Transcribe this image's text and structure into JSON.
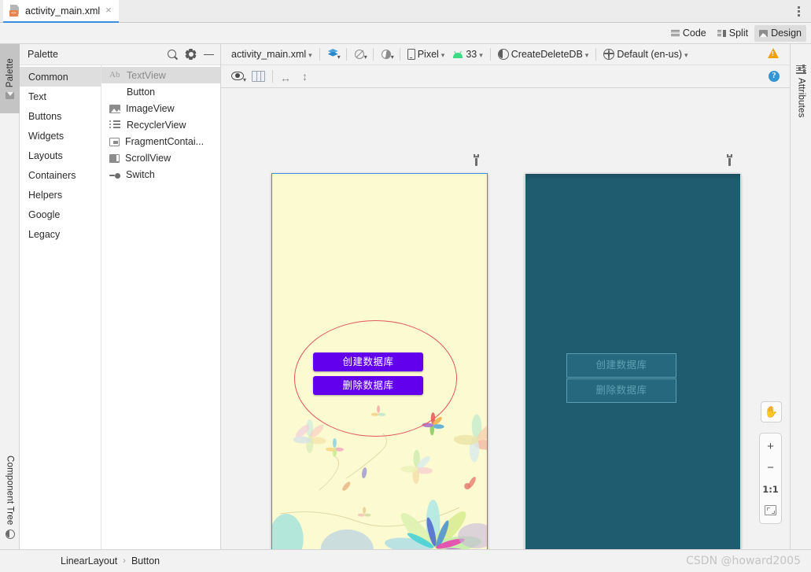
{
  "window": {
    "file_tab": "activity_main.xml",
    "tab_close": "×",
    "more_menu": "more-options"
  },
  "editor_modes": [
    {
      "label": "Code",
      "icon": "code-lines-icon",
      "active": false
    },
    {
      "label": "Split",
      "icon": "split-view-icon",
      "active": false
    },
    {
      "label": "Design",
      "icon": "design-view-icon",
      "active": true
    }
  ],
  "left_strip": {
    "palette_tab": "Palette",
    "component_tree_tab": "Component Tree"
  },
  "right_strip": {
    "attributes_tab": "Attributes"
  },
  "palette": {
    "title": "Palette",
    "search_icon": "search-icon",
    "gear_icon": "gear-icon",
    "minimize_icon": "minimize-icon",
    "categories": [
      {
        "label": "Common",
        "selected": true
      },
      {
        "label": "Text",
        "selected": false
      },
      {
        "label": "Buttons",
        "selected": false
      },
      {
        "label": "Widgets",
        "selected": false
      },
      {
        "label": "Layouts",
        "selected": false
      },
      {
        "label": "Containers",
        "selected": false
      },
      {
        "label": "Helpers",
        "selected": false
      },
      {
        "label": "Google",
        "selected": false
      },
      {
        "label": "Legacy",
        "selected": false
      }
    ],
    "widgets": [
      {
        "label": "TextView",
        "icon": "textview-icon",
        "selected": true
      },
      {
        "label": "Button",
        "icon": "button-icon",
        "selected": false
      },
      {
        "label": "ImageView",
        "icon": "imageview-icon",
        "selected": false
      },
      {
        "label": "RecyclerView",
        "icon": "recyclerview-icon",
        "selected": false
      },
      {
        "label": "FragmentContai...",
        "icon": "fragment-container-icon",
        "selected": false
      },
      {
        "label": "ScrollView",
        "icon": "scrollview-icon",
        "selected": false
      },
      {
        "label": "Switch",
        "icon": "switch-icon",
        "selected": false
      }
    ]
  },
  "design_toolbar": {
    "file_selector": "activity_main.xml",
    "view_modes_icon": "layers-icon",
    "blueprint_icon": "blueprint-toggle-icon",
    "theme_contrast_icon": "half-moon-icon",
    "device": "Pixel",
    "device_icon": "phone-icon",
    "api_level": "33",
    "api_icon": "android-icon",
    "theme": "CreateDeleteDB",
    "theme_icon": "theme-icon",
    "locale": "Default (en-us)",
    "locale_icon": "globe-icon",
    "warning_icon": "warning-triangle-icon"
  },
  "design_toolbar2": {
    "visibility_icon": "eye-icon",
    "columns_icon": "columns-layout-icon",
    "width_icon": "horizontal-resize-icon",
    "height_icon": "vertical-resize-icon",
    "help_icon": "help-icon"
  },
  "preview": {
    "design": {
      "name": "design-render-preview",
      "background_color": "#fcfad0",
      "selection_color": "#3b8ee0",
      "ellipse_color": "#e05a5a",
      "buttons": [
        {
          "label": "创建数据库",
          "color": "#6200ee"
        },
        {
          "label": "删除数据库",
          "color": "#6200ee"
        }
      ],
      "config_icon": "wrench-icon",
      "resize_handle": "resize-handle"
    },
    "blueprint": {
      "name": "blueprint-render-preview",
      "background_color": "#1f5c70",
      "outline_color": "#5c9fb3",
      "buttons": [
        {
          "label": "创建数据库"
        },
        {
          "label": "删除数据库"
        }
      ],
      "config_icon": "wrench-icon"
    }
  },
  "zoom_controls": {
    "pan_label": "✋",
    "zoom_in": "+",
    "zoom_out": "−",
    "actual_size": "1:1",
    "fit_label": "zoom-to-fit-icon"
  },
  "status": {
    "breadcrumb": [
      "LinearLayout",
      "Button"
    ],
    "separator": "›",
    "watermark": "CSDN @howard2005"
  }
}
